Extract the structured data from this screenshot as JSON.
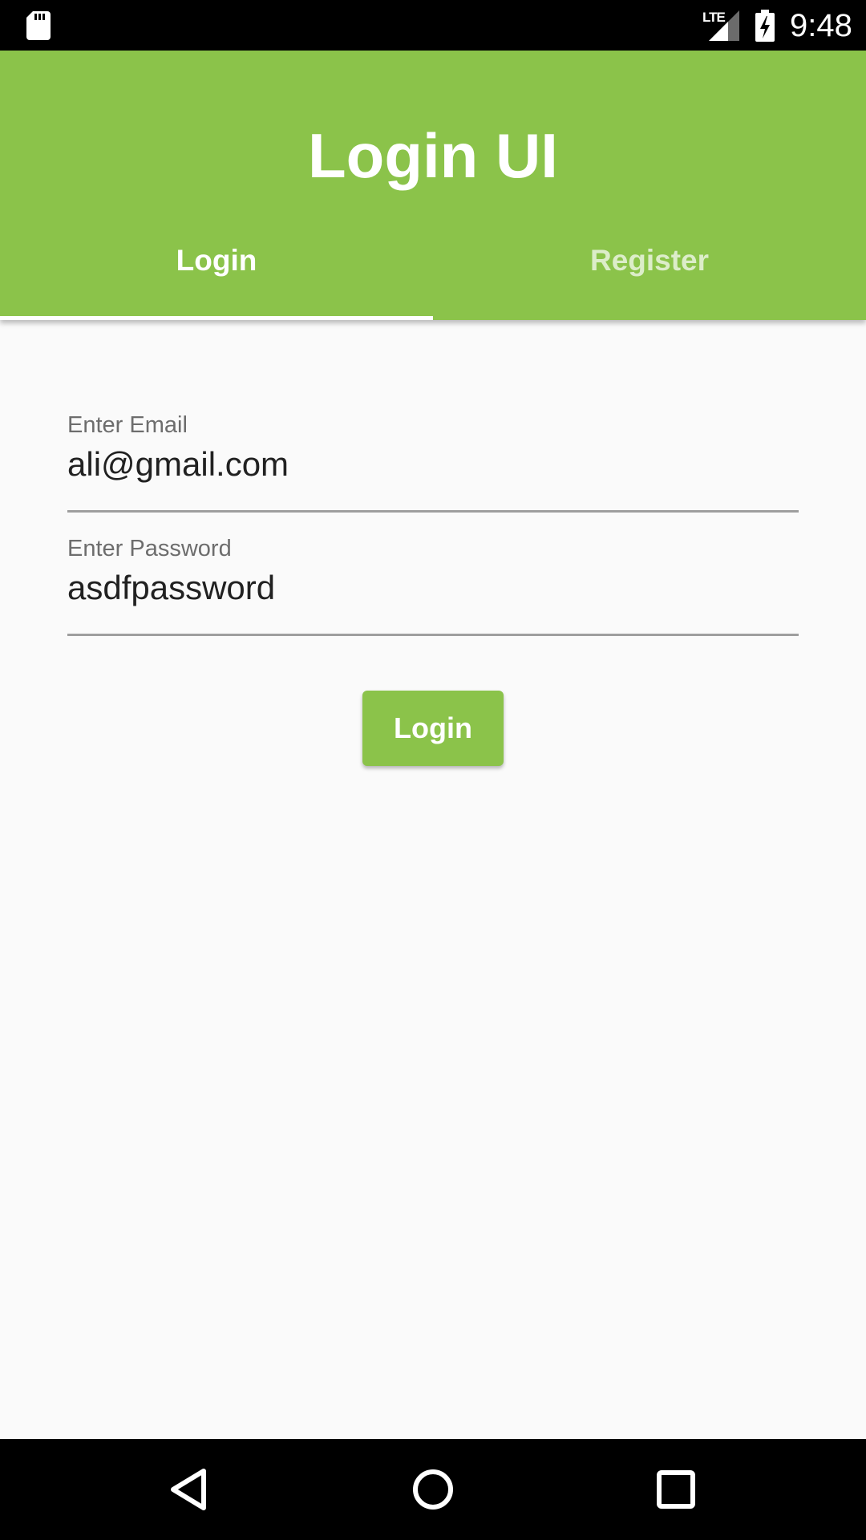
{
  "status_bar": {
    "network_label": "LTE",
    "time": "9:48",
    "icons": [
      "sd-card-icon",
      "signal-icon",
      "battery-charging-icon"
    ]
  },
  "app_bar": {
    "title": "Login UI",
    "background_color": "#8bc34a"
  },
  "tabs": [
    {
      "label": "Login",
      "selected": true
    },
    {
      "label": "Register",
      "selected": false
    }
  ],
  "form": {
    "email": {
      "label": "Enter Email",
      "value": "ali@gmail.com"
    },
    "password": {
      "label": "Enter Password",
      "value": "asdfpassword"
    },
    "submit_label": "Login"
  },
  "nav_bar": {
    "icons": [
      "back-icon",
      "home-icon",
      "recents-icon"
    ]
  }
}
